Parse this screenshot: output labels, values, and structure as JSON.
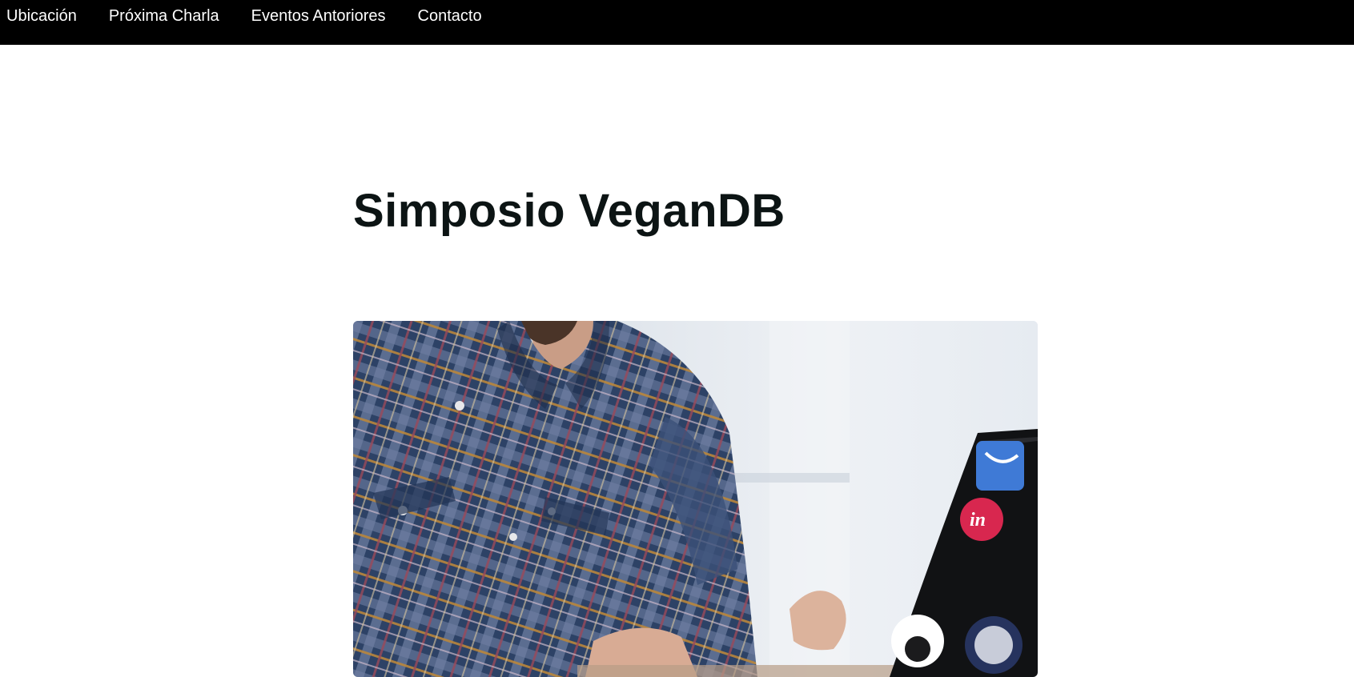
{
  "nav": {
    "items": [
      {
        "label": "Ubicación"
      },
      {
        "label": "Próxima Charla"
      },
      {
        "label": "Eventos Antoriores"
      },
      {
        "label": "Contacto"
      }
    ]
  },
  "main": {
    "title": "Simposio VeganDB",
    "hero_image": {
      "description_icon": "photo-person-laptop-icon"
    }
  },
  "colors": {
    "nav_background": "#000000",
    "nav_text": "#ffffff",
    "title_text": "#0c1414",
    "page_background": "#ffffff"
  }
}
